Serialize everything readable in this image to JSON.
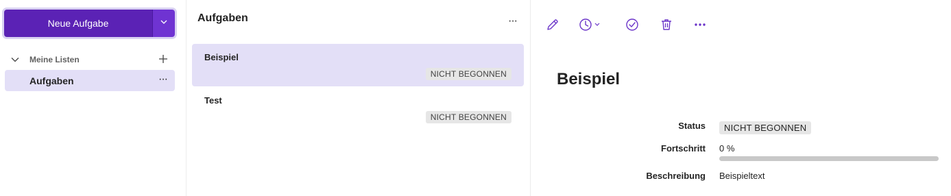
{
  "sidebar": {
    "new_task_label": "Neue Aufgabe",
    "lists_header": "Meine Listen",
    "lists": [
      {
        "label": "Aufgaben",
        "more": "···"
      }
    ]
  },
  "tasklist": {
    "title": "Aufgaben",
    "more": "···",
    "tasks": [
      {
        "title": "Beispiel",
        "status": "NICHT BEGONNEN",
        "selected": true
      },
      {
        "title": "Test",
        "status": "NICHT BEGONNEN",
        "selected": false
      }
    ]
  },
  "detail": {
    "toolbar": [
      "pencil-icon",
      "clock-icon",
      "check-circle-icon",
      "trash-icon",
      "more-icon"
    ],
    "more": "···",
    "title": "Beispiel",
    "status_label": "Status",
    "status_value": "NICHT BEGONNEN",
    "progress_label": "Fortschritt",
    "progress_value": "0 %",
    "progress_fraction": 0,
    "description_label": "Beschreibung",
    "description_value": "Beispieltext"
  },
  "colors": {
    "accent": "#5b22b5",
    "accent_light": "#6f33d2",
    "selection": "#e3dff7",
    "badge_bg": "#e6e6e6",
    "icon": "#6b35c9"
  }
}
